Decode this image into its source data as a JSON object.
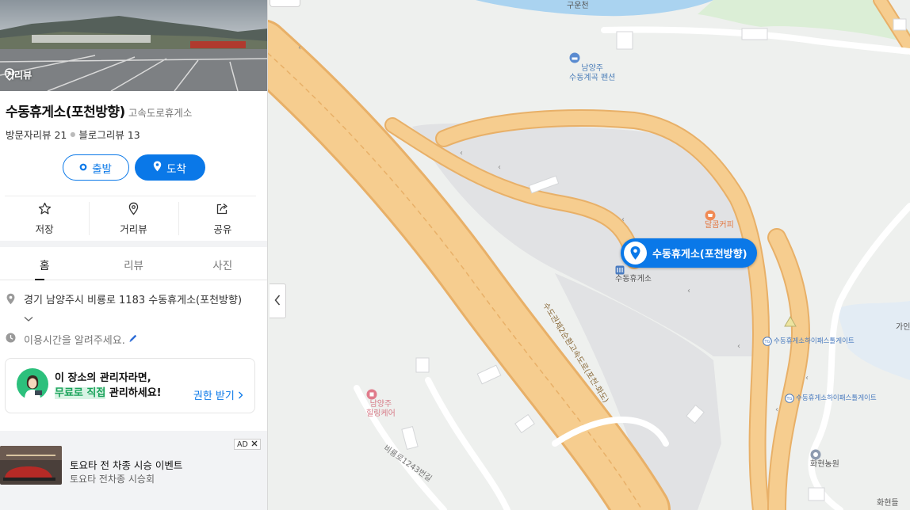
{
  "place": {
    "streetview_tag": "거리뷰",
    "title": "수동휴게소(포천방향)",
    "category": "고속도로휴게소",
    "visitor_reviews": "방문자리뷰 21",
    "blog_reviews": "블로그리뷰 13",
    "depart_label": "출발",
    "arrive_label": "도착"
  },
  "actions": [
    {
      "label": "저장",
      "icon": "star-icon"
    },
    {
      "label": "거리뷰",
      "icon": "streetview-pin-icon"
    },
    {
      "label": "공유",
      "icon": "share-icon"
    }
  ],
  "tabs": [
    "홈",
    "리뷰",
    "사진"
  ],
  "info": {
    "address": "경기 남양주시 비룡로 1183 수동휴게소(포천방향)",
    "hours_prompt": "이용시간을 알려주세요."
  },
  "manager_box": {
    "line1": "이 장소의 관리자라면,",
    "highlight": "무료로 직접",
    "line2_rest": " 관리하세요!",
    "claim_label": "권한 받기"
  },
  "ad": {
    "badge": "AD",
    "title": "토요타 전 차종 시승 이벤트",
    "subtitle": "토요타 전차종 시승회"
  },
  "map": {
    "labels": {
      "river": "구운천",
      "pension": "남양주\n수동계곡 펜션",
      "cafe": "달콤커피",
      "rest_area": "수동휴게소",
      "gate1": "수동휴게소하이패스톨게이트",
      "gate2": "수동휴게소하이패스톨게이트",
      "healing": "남양주\n힐링케어",
      "road_a": "수도권제2순환고속도로(포천-화도)",
      "road_b": "비룡로1243번길",
      "farm": "화현농원",
      "hwahyeon": "화현들",
      "edge_right": "가인"
    },
    "selected_pin": "수동휴게소(포천방향)",
    "colors": {
      "highway": "#f6cd8f",
      "highway_edge": "#e8b068",
      "base": "#eef0ee",
      "water": "#aad3f0",
      "green": "#dbeed6",
      "accent": "#0a78e8"
    }
  }
}
